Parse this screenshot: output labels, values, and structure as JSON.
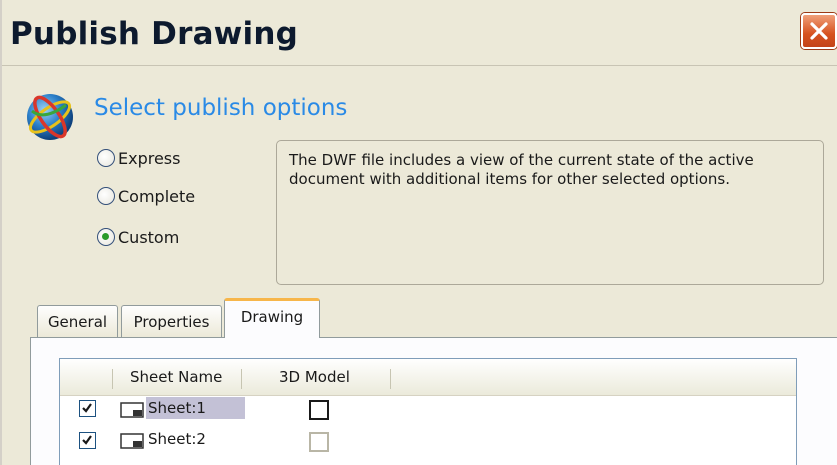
{
  "window": {
    "title": "Publish Drawing",
    "close_icon": "close-icon",
    "accent_close": "#d6511e"
  },
  "header": {
    "icon": "globe-icon",
    "title": "Select publish options",
    "title_color": "#2a8ae6"
  },
  "options": [
    {
      "label": "Express",
      "selected": false
    },
    {
      "label": "Complete",
      "selected": false
    },
    {
      "label": "Custom",
      "selected": true
    }
  ],
  "description": "The DWF file includes a view of the current state of the active document with additional items for other selected options.",
  "tabs": [
    {
      "label": "General",
      "active": false
    },
    {
      "label": "Properties",
      "active": false
    },
    {
      "label": "Drawing",
      "active": true
    }
  ],
  "sheet_table": {
    "columns": [
      "Sheet Name",
      "3D Model"
    ],
    "rows": [
      {
        "checked": true,
        "icon": "sheet-icon",
        "name": "Sheet:1",
        "selected": true,
        "model_3d": false,
        "model_3d_enabled": true
      },
      {
        "checked": true,
        "icon": "sheet-icon",
        "name": "Sheet:2",
        "selected": false,
        "model_3d": false,
        "model_3d_enabled": false
      }
    ]
  }
}
